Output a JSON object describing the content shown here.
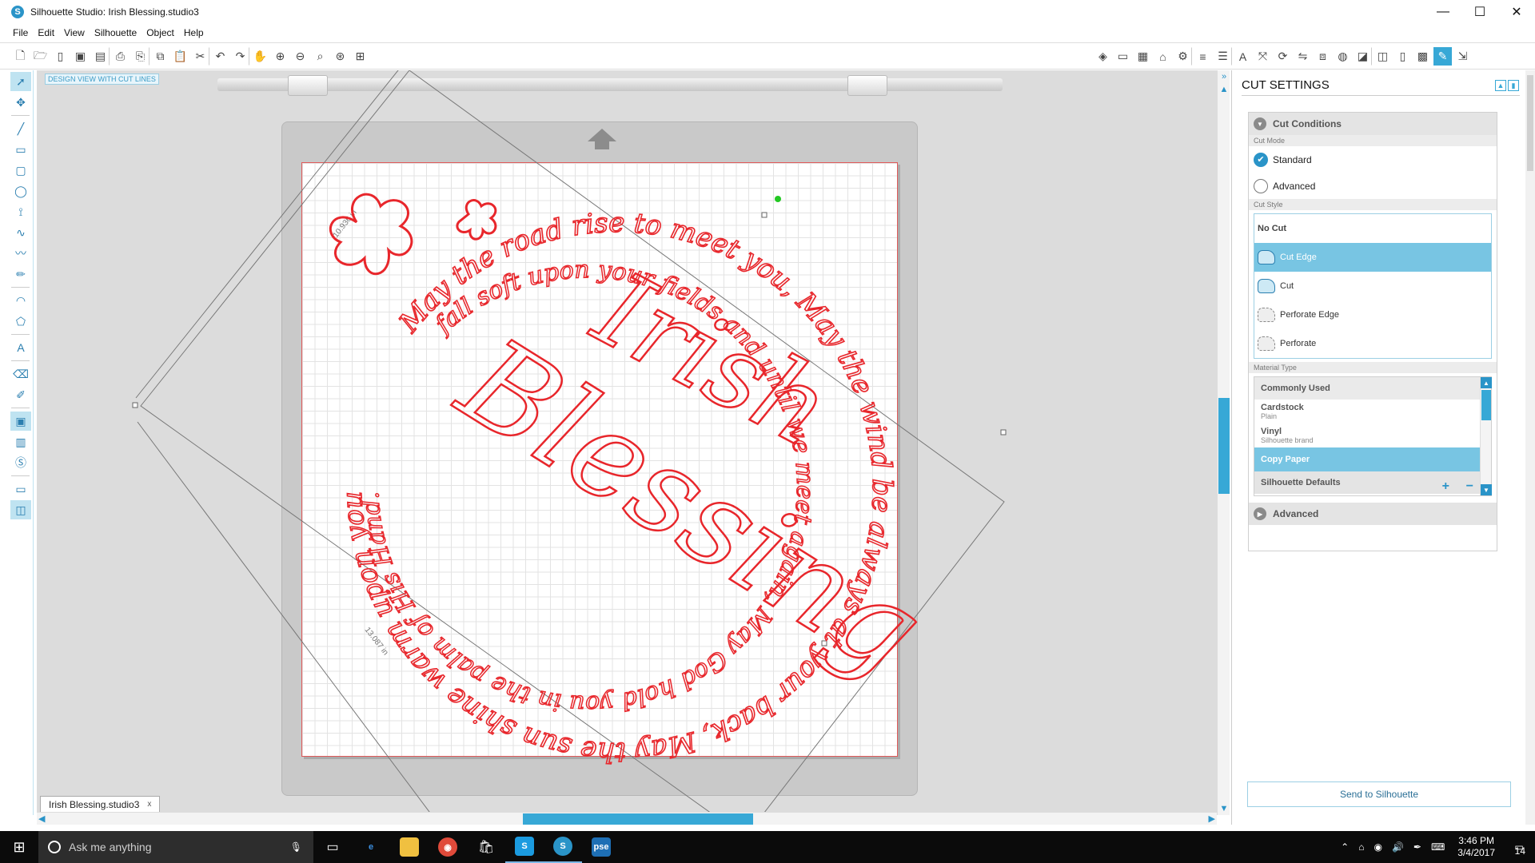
{
  "window": {
    "title": "Silhouette Studio: Irish Blessing.studio3",
    "app_icon": "S",
    "controls": {
      "minimize": "—",
      "maximize": "☐",
      "close": "✕"
    }
  },
  "menu": [
    "File",
    "Edit",
    "View",
    "Silhouette",
    "Object",
    "Help"
  ],
  "canvas": {
    "view_label": "DESIGN VIEW WITH CUT LINES",
    "dim_width": "10.936 in",
    "dim_height": "13.087 in",
    "artwork_lines": {
      "outer_ring": "May the road rise to meet you, May the wind be always at your back, May the sun shine warm upon your face; the rain",
      "inner_ring": "fall soft upon your fields and until we meet again, May God hold you in the palm of His Hand.",
      "word1": "Irish",
      "word2": "Blessing"
    },
    "cut_color": "#e8262b",
    "accent": "#37a8d6"
  },
  "document_tab": {
    "label": "Irish Blessing.studio3",
    "close": "x"
  },
  "panel": {
    "title": "CUT SETTINGS",
    "cut_conditions": "Cut Conditions",
    "cut_mode_label": "Cut Mode",
    "modes": [
      {
        "label": "Standard",
        "selected": true
      },
      {
        "label": "Advanced",
        "selected": false
      }
    ],
    "cut_style_label": "Cut Style",
    "styles": [
      {
        "label": "No Cut"
      },
      {
        "label": "Cut Edge"
      },
      {
        "label": "Cut"
      },
      {
        "label": "Perforate Edge"
      },
      {
        "label": "Perforate"
      }
    ],
    "material_type_label": "Material Type",
    "materials": {
      "header": "Commonly Used",
      "items": [
        {
          "name": "Cardstock",
          "sub": "Plain"
        },
        {
          "name": "Vinyl",
          "sub": "Silhouette brand"
        }
      ],
      "selected": "Copy Paper",
      "footer": "Silhouette Defaults"
    },
    "advanced": "Advanced",
    "send_button": "Send to Silhouette"
  },
  "taskbar": {
    "search_placeholder": "Ask me anything",
    "time": "3:46 PM",
    "date": "3/4/2017",
    "notification_count": "14",
    "pse_label": "pse"
  }
}
